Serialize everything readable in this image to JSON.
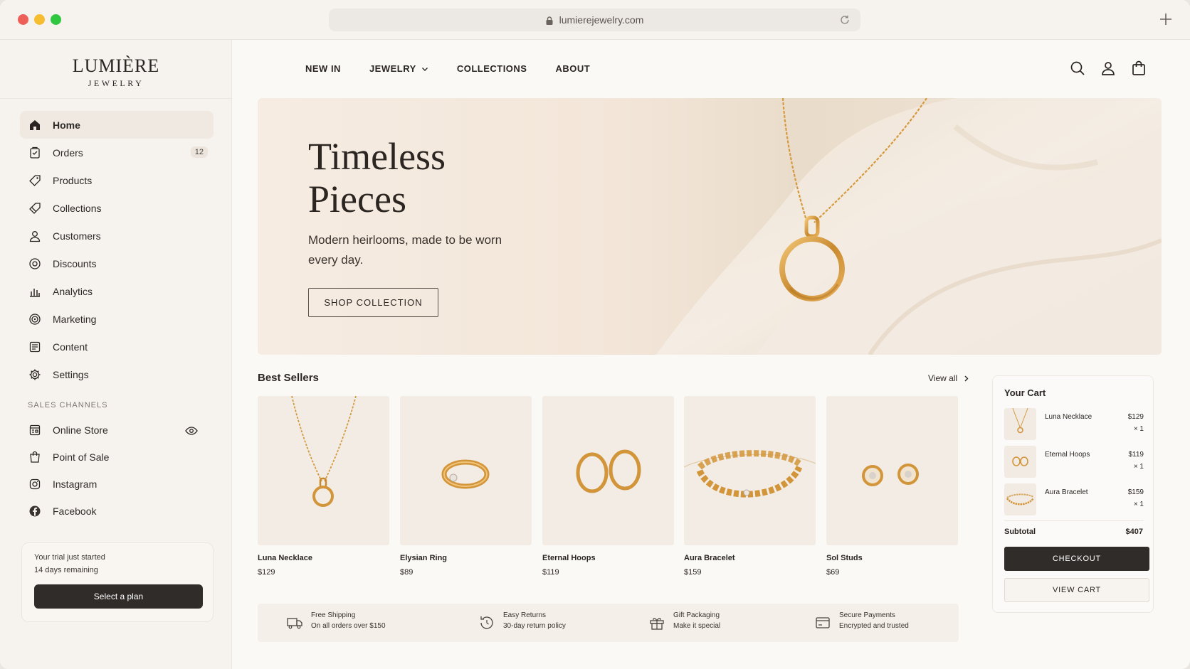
{
  "browser": {
    "url": "lumierejewelry.com"
  },
  "brand": {
    "name": "LUMIÈRE",
    "subtitle": "JEWELRY"
  },
  "sidebar": {
    "items": [
      {
        "label": "Home",
        "icon": "home-icon",
        "active": true
      },
      {
        "label": "Orders",
        "icon": "orders-icon",
        "badge": "12"
      },
      {
        "label": "Products",
        "icon": "tag-icon"
      },
      {
        "label": "Collections",
        "icon": "collections-icon"
      },
      {
        "label": "Customers",
        "icon": "person-icon"
      },
      {
        "label": "Discounts",
        "icon": "discount-icon"
      },
      {
        "label": "Analytics",
        "icon": "bar-chart-icon"
      },
      {
        "label": "Marketing",
        "icon": "target-icon"
      },
      {
        "label": "Content",
        "icon": "document-icon"
      },
      {
        "label": "Settings",
        "icon": "gear-icon"
      }
    ],
    "sales_channels_label": "SALES CHANNELS",
    "channels": [
      {
        "label": "Online Store",
        "icon": "store-icon"
      },
      {
        "label": "Point of Sale",
        "icon": "shopping-bag-icon"
      },
      {
        "label": "Instagram",
        "icon": "instagram-icon"
      },
      {
        "label": "Facebook",
        "icon": "facebook-icon"
      }
    ],
    "trial": {
      "title": "Your trial just started",
      "subtitle": "14 days remaining",
      "button": "Select a plan"
    }
  },
  "topnav": {
    "items": [
      "NEW IN",
      "JEWELRY",
      "COLLECTIONS",
      "ABOUT"
    ]
  },
  "hero": {
    "title_line1": "Timeless",
    "title_line2": "Pieces",
    "subtitle": "Modern heirlooms, made to be worn every day.",
    "button": "SHOP COLLECTION"
  },
  "best_sellers": {
    "title": "Best Sellers",
    "view_all": "View all",
    "products": [
      {
        "name": "Luna Necklace",
        "price": "$129"
      },
      {
        "name": "Elysian Ring",
        "price": "$89"
      },
      {
        "name": "Eternal Hoops",
        "price": "$119"
      },
      {
        "name": "Aura Bracelet",
        "price": "$159"
      },
      {
        "name": "Sol Studs",
        "price": "$69"
      }
    ]
  },
  "features": [
    {
      "title": "Free Shipping",
      "subtitle": "On all orders over $150",
      "icon": "truck-icon"
    },
    {
      "title": "Easy Returns",
      "subtitle": "30-day return policy",
      "icon": "return-icon"
    },
    {
      "title": "Gift Packaging",
      "subtitle": "Make it special",
      "icon": "gift-icon"
    },
    {
      "title": "Secure Payments",
      "subtitle": "Encrypted and trusted",
      "icon": "card-icon"
    }
  ],
  "cart": {
    "title": "Your Cart",
    "items": [
      {
        "name": "Luna Necklace",
        "price": "$129",
        "qty": "× 1"
      },
      {
        "name": "Eternal Hoops",
        "price": "$119",
        "qty": "× 1"
      },
      {
        "name": "Aura Bracelet",
        "price": "$159",
        "qty": "× 1"
      }
    ],
    "subtotal_label": "Subtotal",
    "subtotal_value": "$407",
    "checkout": "CHECKOUT",
    "view_cart": "VIEW CART"
  },
  "colors": {
    "accent_dark": "#2f2c2a",
    "gold": "#d49a3e",
    "background": "#fbf9f6"
  }
}
